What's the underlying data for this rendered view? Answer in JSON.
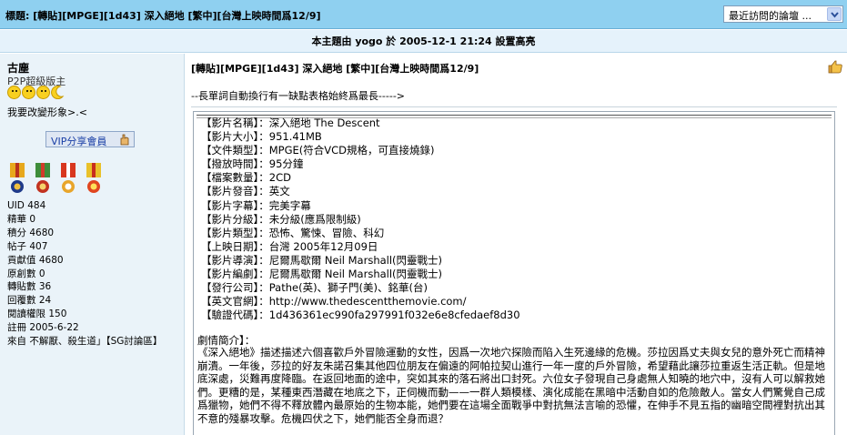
{
  "header": {
    "title": "標題: [轉貼][MPGE][1d43] 深入絕地 [繁中][台灣上映時間爲12/9]",
    "forum_select": "最近訪問的論壇 ..."
  },
  "notice": "本主題由 yogo 於 2005-12-1 21:24 設置高亮",
  "user": {
    "name": "古塵",
    "title": "P2P超級版主",
    "signature": "我要改變形象>.<",
    "vip_label": "VIP分享會員",
    "stats": [
      "UID 484",
      "精華 0",
      "積分 4680",
      "帖子 407",
      "貢獻值 4680",
      "原創數 0",
      "轉貼數 36",
      "回覆數 24",
      "閱讀權限 150",
      "註冊 2005-6-22",
      "來自 不解厭、殺生道」【SG討論區】"
    ]
  },
  "post": {
    "title": "[轉貼][MPGE][1d43] 深入絕地 [繁中][台灣上映時間爲12/9]",
    "note": "--長單詞自動換行有一缺點表格始終爲最長----->",
    "fields": [
      "【影片名稱】：深入絕地 The Descent",
      "【影片大小】：951.41MB",
      "【文件類型】：MPGE(符合VCD規格，可直接燒錄)",
      "【撥放時間】：95分鐘",
      "【檔案數量】：2CD",
      "【影片發音】：英文",
      "【影片字幕】：完美字幕",
      "【影片分級】：未分級(應爲限制級)",
      "【影片類型】：恐怖、驚悚、冒險、科幻",
      "【上映日期】：台灣 2005年12月09日",
      "【影片導演】：尼爾馬歇爾 Neil Marshall(閃靈戰士)",
      "【影片編劇】：尼爾馬歇爾 Neil Marshall(閃靈戰士)",
      "【發行公司】：Pathe(英)、獅子門(美)、銘華(台)",
      "【英文官網】：http://www.thedescentthemovie.com/",
      "【驗證代碼】：1d436361ec990fa297991f032e6e8cfedaef8d30"
    ],
    "synopsis_title": "劇情簡介】：",
    "synopsis": "《深入絕地》描述描述六個喜歡戶外冒險運動的女性，因爲一次地穴探險而陷入生死邊緣的危機。莎拉因爲丈夫與女兒的意外死亡而精神崩潰。一年後，莎拉的好友朱諾召集其他四位朋友在偏遠的阿帕拉契山進行一年一度的戶外冒險，希望藉此讓莎拉重返生活正軌。但是地底深處，災難再度降臨。在返回地面的途中，突如其來的落石將出口封死。六位女子發現自己身處無人知曉的地穴中，沒有人可以解救她們。更糟的是，某種東西潛藏在地底之下，正伺機而動——一群人類模樣、演化成能在黑暗中活動自如的危險敵人。當女人們驚覺自己成爲獵物，她們不得不釋放體內最原始的生物本能，她們要在這場全面戰爭中對抗無法言喻的恐懼，在伸手不見五指的幽暗空間裡對抗出其不意的殘暴攻擊。危機四伏之下，她們能否全身而退？"
  }
}
